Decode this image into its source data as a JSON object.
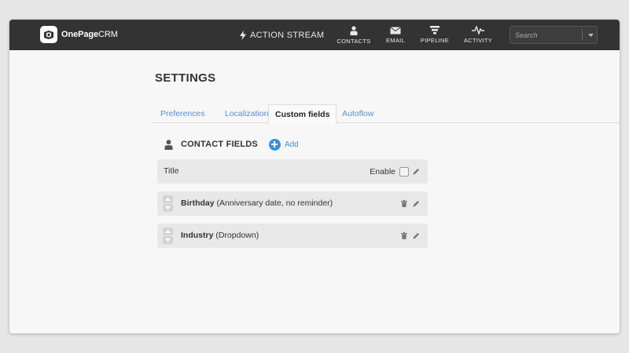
{
  "app": {
    "logo_bold": "OnePage",
    "logo_light": "CRM"
  },
  "nav": {
    "action_stream": "ACTION STREAM",
    "items": [
      {
        "label": "CONTACTS",
        "icon": "person-icon"
      },
      {
        "label": "EMAIL",
        "icon": "envelope-icon"
      },
      {
        "label": "PIPELINE",
        "icon": "funnel-icon"
      },
      {
        "label": "ACTIVITY",
        "icon": "pulse-icon"
      }
    ],
    "search_placeholder": "Search"
  },
  "page": {
    "title": "SETTINGS"
  },
  "tabs": [
    {
      "label": "Preferences",
      "active": false
    },
    {
      "label": "Localization",
      "active": false
    },
    {
      "label": "Custom fields",
      "active": true
    },
    {
      "label": "Autoflow",
      "active": false
    }
  ],
  "contact_fields": {
    "heading": "CONTACT FIELDS",
    "add_label": "Add",
    "rows": [
      {
        "label": "Title",
        "enable_label": "Enable",
        "enabled": false
      },
      {
        "name": "Birthday",
        "detail": "(Anniversary date, no reminder)"
      },
      {
        "name": "Industry",
        "detail": "(Dropdown)"
      }
    ]
  },
  "colors": {
    "topbar": "#333333",
    "link": "#5b8cc6",
    "accent": "#3d8fd6",
    "row_bg": "#e8e8e8"
  }
}
